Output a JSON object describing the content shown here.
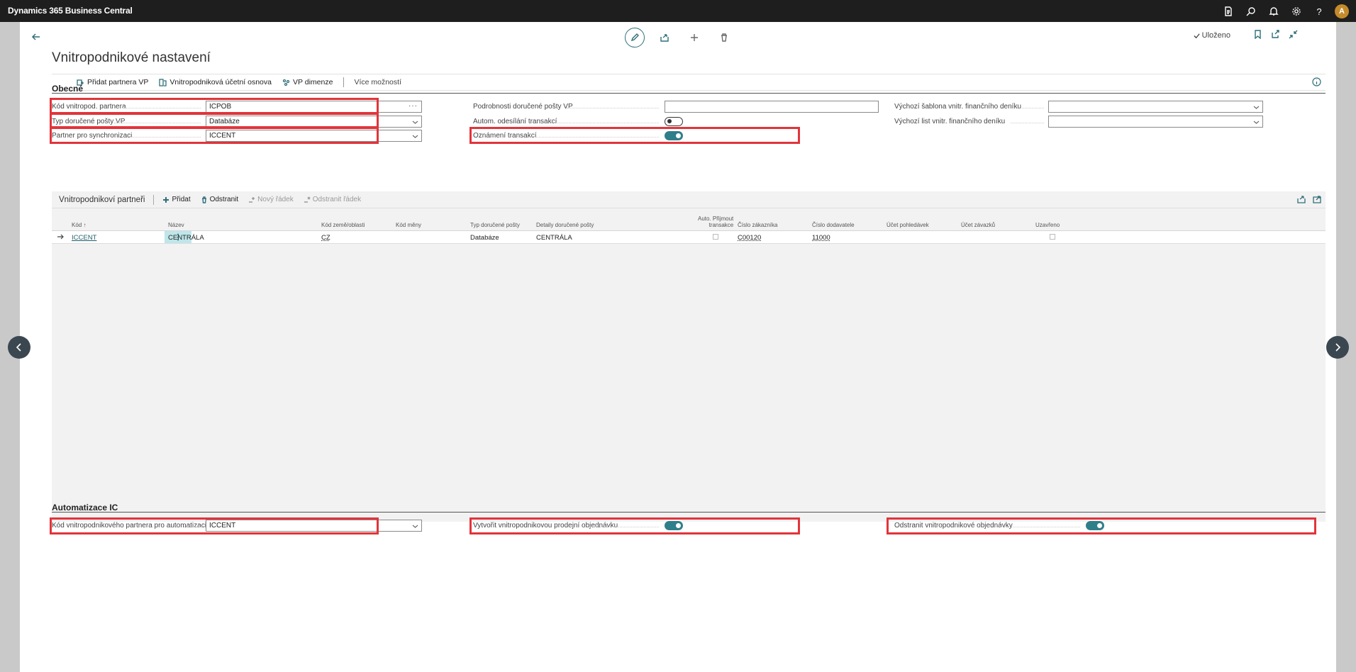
{
  "app": {
    "title": "Dynamics 365 Business Central",
    "avatar_initial": "A",
    "help_glyph": "?"
  },
  "header": {
    "saved_label": "Uloženo",
    "page_title": "Vnitropodnikové nastavení"
  },
  "actions": {
    "add_partner": "Přidat partnera VP",
    "chart_of_accounts": "Vnitropodniková účetní osnova",
    "dimensions": "VP dimenze",
    "more": "Více možností"
  },
  "general": {
    "title": "Obecné",
    "ic_partner_code_label": "Kód vnitropod. partnera",
    "ic_partner_code_value": "ICPOB",
    "inbox_type_label": "Typ doručené pošty VP",
    "inbox_type_value": "Databáze",
    "sync_partner_label": "Partner pro synchronizaci",
    "sync_partner_value": "ICCENT",
    "inbox_details_label": "Podrobnosti doručené pošty VP",
    "inbox_details_value": "",
    "auto_send_label": "Autom. odesílání transakcí",
    "auto_send_on": false,
    "notify_label": "Oznámení transakcí",
    "notify_on": true,
    "default_template_label": "Výchozí šablona vnitr. finančního deníku",
    "default_template_value": "",
    "default_batch_label": "Výchozí list vnitr. finančního deníku",
    "default_batch_value": ""
  },
  "partners": {
    "title": "Vnitropodnikoví partneři",
    "actions": {
      "add": "Přidat",
      "delete": "Odstranit",
      "new_line": "Nový řádek",
      "delete_line": "Odstranit řádek"
    },
    "columns": {
      "code": "Kód",
      "sort_arrow": "↑",
      "name": "Název",
      "country": "Kód země/oblasti",
      "currency": "Kód měny",
      "inbox_type": "Typ doručené pošty",
      "inbox_details": "Detaily doručené pošty",
      "auto_accept_1": "Auto. Přijmout",
      "auto_accept_2": "transakce",
      "customer_no": "Číslo zákazníka",
      "vendor_no": "Číslo dodavatele",
      "receivables": "Účet pohledávek",
      "payables": "Účet závazků",
      "blocked": "Uzavřeno"
    },
    "rows": [
      {
        "code": "ICCENT",
        "name": "CENTRÁLA",
        "country": "CZ",
        "currency": "",
        "inbox_type": "Databáze",
        "inbox_details": "CENTRÁLA",
        "auto_accept": false,
        "customer_no": "C00120",
        "vendor_no": "11000",
        "receivables": "",
        "payables": "",
        "blocked": false
      }
    ]
  },
  "automation": {
    "title": "Automatizace IC",
    "partner_code_label": "Kód vnitropodnikového partnera pro automatizaci pr...",
    "partner_code_value": "ICCENT",
    "create_sales_order_label": "Vytvořit vnitropodnikovou prodejní objednávku",
    "create_sales_order_on": true,
    "delete_orders_label": "Odstranit vnitropodnikové objednávky",
    "delete_orders_on": true
  },
  "colors": {
    "accent": "#2f7f8a",
    "highlight": "#e2343a",
    "topbar": "#1e1e1e"
  }
}
